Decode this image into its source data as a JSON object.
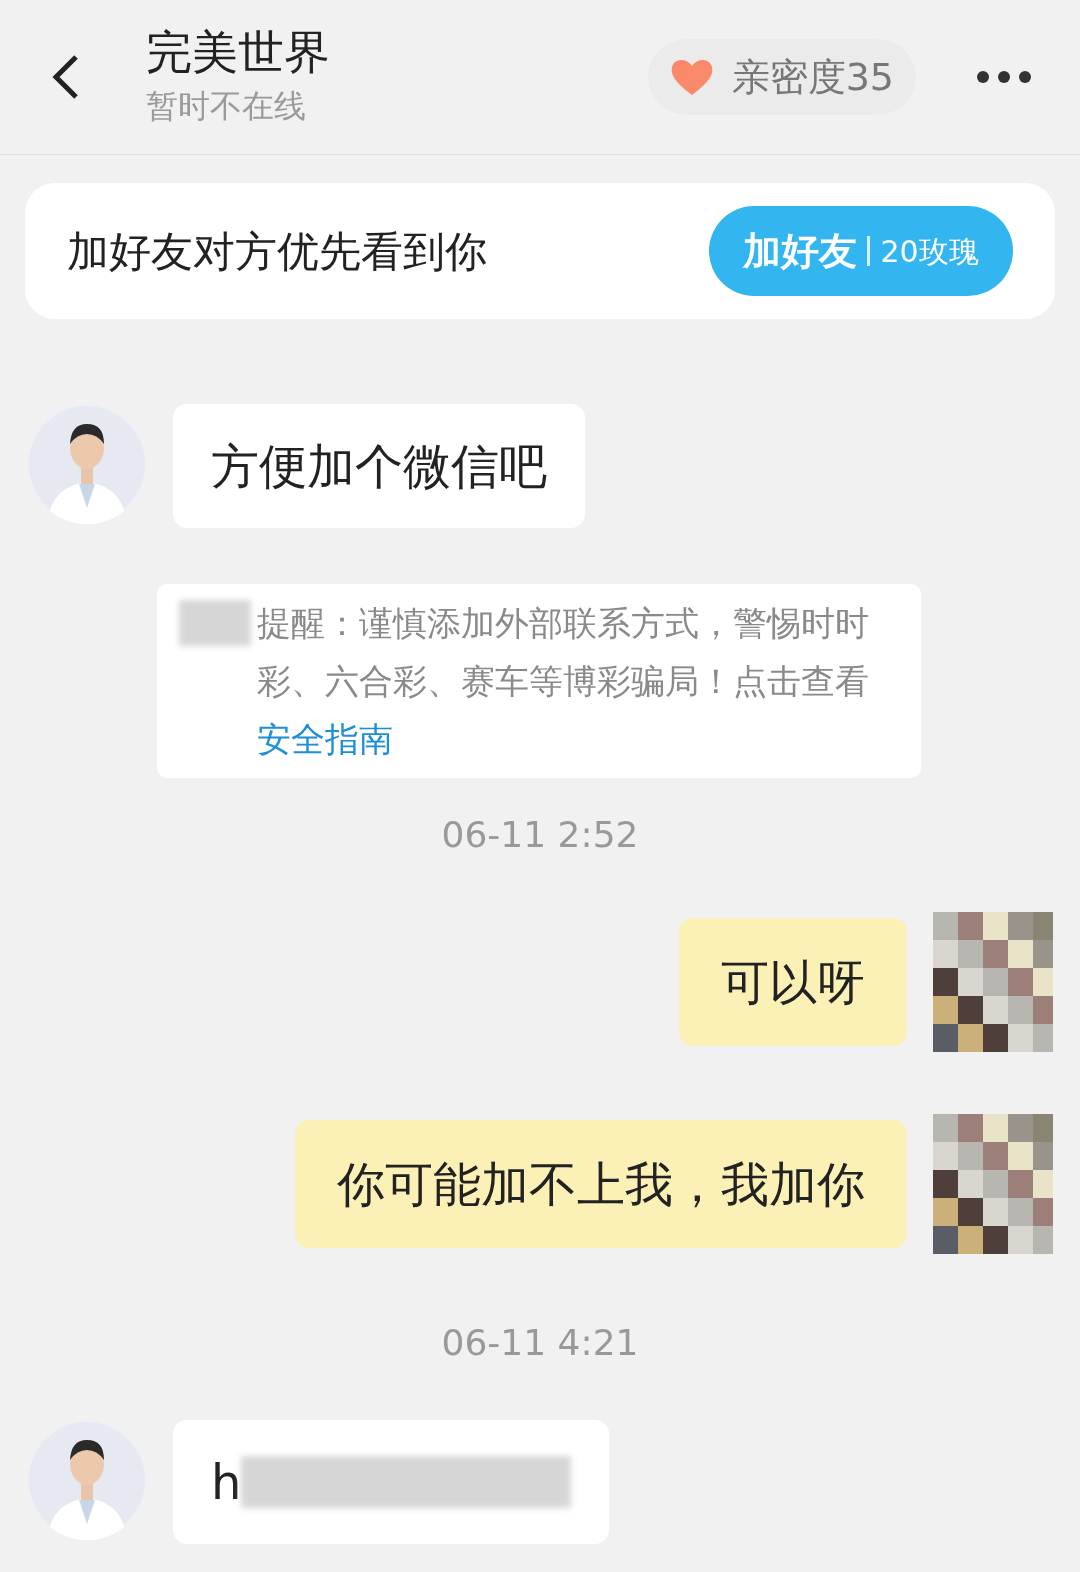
{
  "header": {
    "title": "完美世界",
    "status": "暂时不在线",
    "intimacy": "亲密度35"
  },
  "friend_card": {
    "text": "加好友对方优先看到你",
    "button": "加好友",
    "cost": "20玫瑰"
  },
  "messages": [
    {
      "kind": "incoming",
      "text": "方便加个微信吧"
    },
    {
      "kind": "notice",
      "redacted": true,
      "text": "提醒：谨慎添加外部联系方式，警惕时时彩、六合彩、赛车等博彩骗局！点击查看",
      "link": "安全指南"
    },
    {
      "kind": "time",
      "text": "06-11 2:52"
    },
    {
      "kind": "outgoing",
      "text": "可以呀"
    },
    {
      "kind": "outgoing",
      "text": "你可能加不上我，我加你"
    },
    {
      "kind": "time",
      "text": "06-11 4:21"
    },
    {
      "kind": "incoming",
      "redacted": true,
      "text": "h"
    }
  ]
}
